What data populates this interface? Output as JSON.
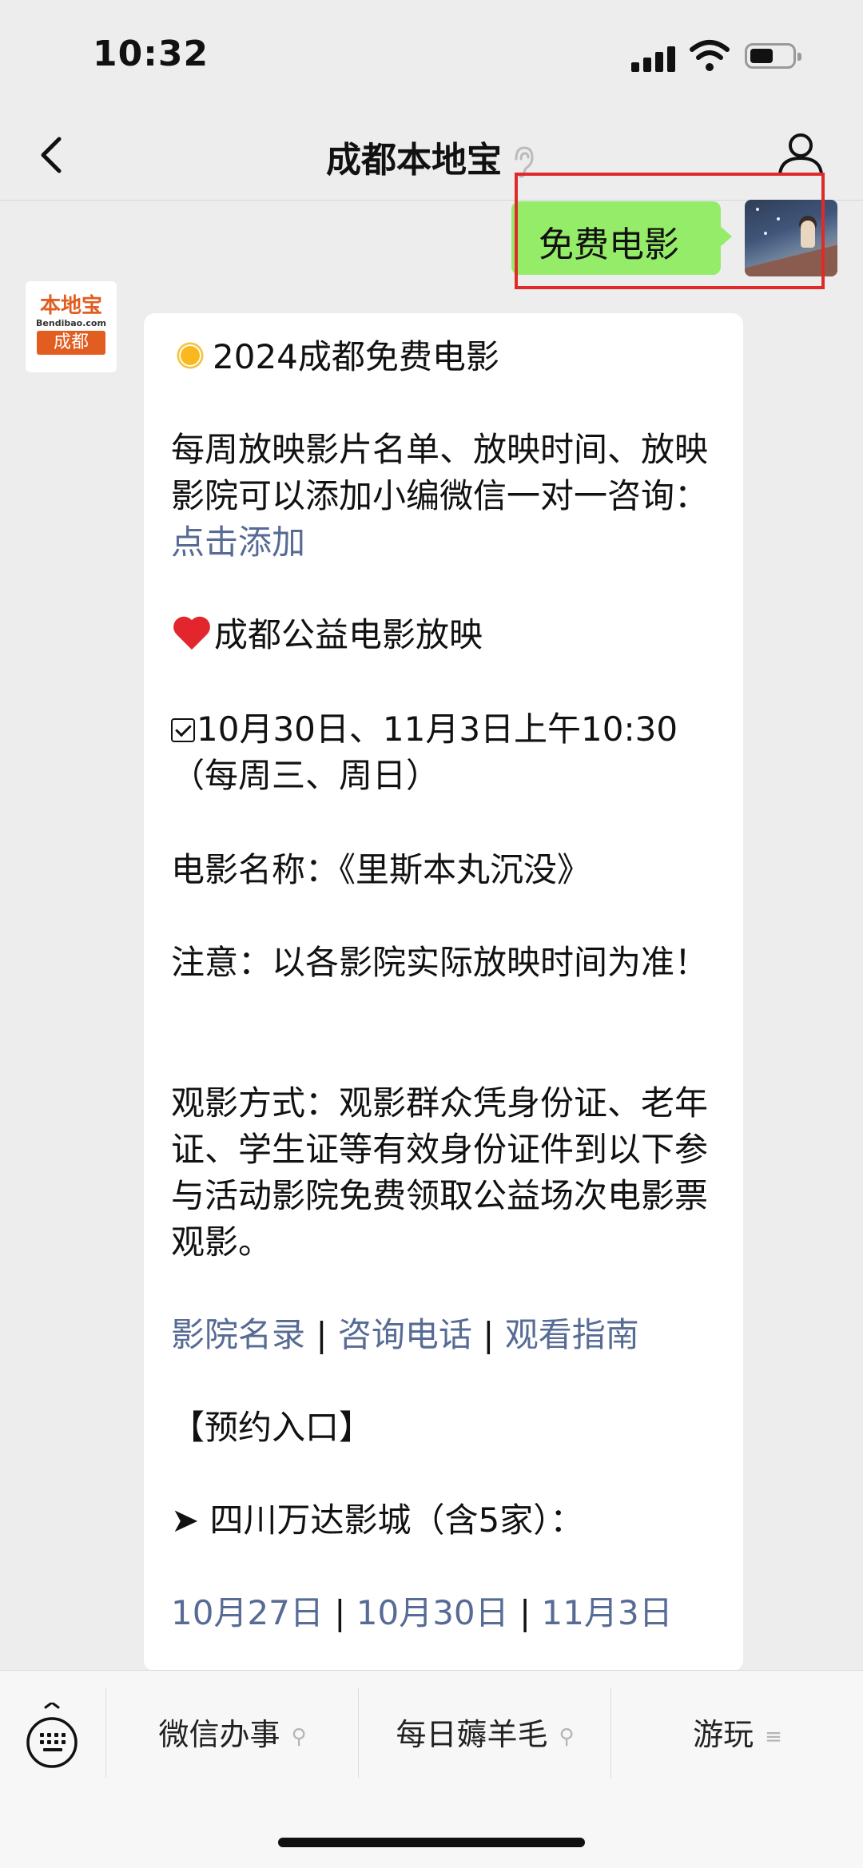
{
  "status_bar": {
    "time": "10:32",
    "battery_level_percent": 55
  },
  "nav": {
    "title": "成都本地宝",
    "icons": [
      "back-chevron-icon",
      "ear-icon",
      "profile-icon"
    ]
  },
  "sent_message": {
    "text": "免费电影"
  },
  "bot_avatar": {
    "line1": "本地宝",
    "line2": "Bendibao.com",
    "line3": "成都"
  },
  "reply": {
    "heading": "2024成都免费电影",
    "intro_prefix": "每周放映影片名单、放映时间、放映影院可以添加小编微信一对一咨询：",
    "intro_link": "点击添加",
    "section_title": "成都公益电影放映",
    "date_line": "10月30日、11月3日上午10:30（每周三、周日）",
    "movie_line": "电影名称：《里斯本丸沉没》",
    "note_line": "注意：以各影院实际放映时间为准！",
    "method_line": "观影方式：观影群众凭身份证、老年证、学生证等有效身份证件到以下参与活动影院免费领取公益场次电影票观影。",
    "links": [
      "影院名录",
      "咨询电话",
      "观看指南"
    ],
    "separator": "|",
    "booking_title": "【预约入口】",
    "cinema_line": "➤ 四川万达影城（含5家）：",
    "date_links": [
      "10月27日",
      "10月30日",
      "11月3日"
    ]
  },
  "menu": {
    "items": [
      "微信办事",
      "每日薅羊毛",
      "游玩"
    ]
  },
  "colors": {
    "background": "#ededed",
    "sent_bubble": "#95ec69",
    "link": "#576b95",
    "highlight_box": "#e02a2a",
    "heart": "#e3262d",
    "brand_orange": "#e25d20"
  }
}
